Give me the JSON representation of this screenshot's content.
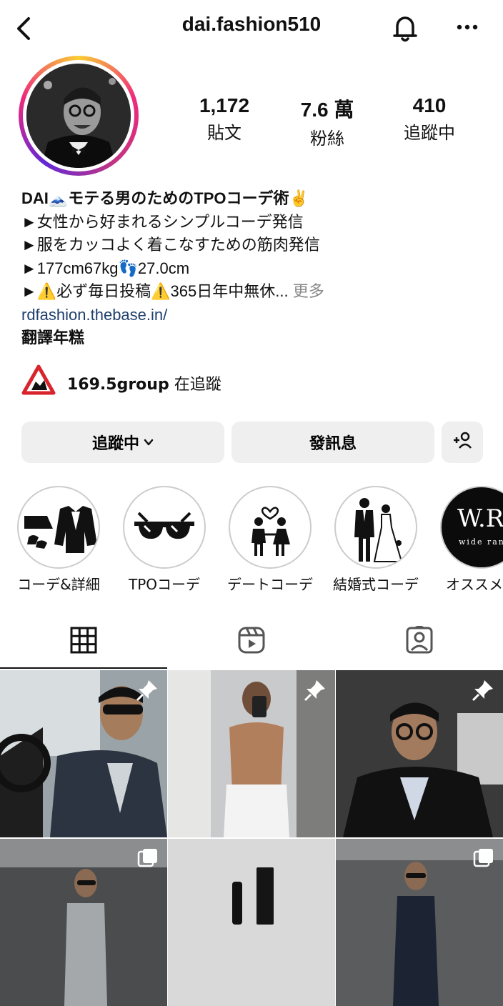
{
  "header": {
    "username": "dai.fashion510",
    "back_icon": "chevron-left-icon",
    "bell_icon": "bell-icon",
    "more_label": "•••"
  },
  "stats": [
    {
      "value": "1,172",
      "label": "貼文"
    },
    {
      "value": "7.6 萬",
      "label": "粉絲"
    },
    {
      "value": "410",
      "label": "追蹤中"
    }
  ],
  "bio": {
    "name_line": "DAI🗻モテる男のためのTPOコーデ術✌️",
    "line1": "►女性から好まれるシンプルコーデ発信",
    "line2": "►服をカッコよく着こなすための筋肉発信",
    "line3": "►177cm67kg👣27.0cm",
    "line4": "►⚠️必ず毎日投稿⚠️365日年中無休...",
    "more": "更多",
    "link": "rdfashion.thebase.in/",
    "translate": "翻譯年糕"
  },
  "group": {
    "name": "169.5group",
    "suffix": "在追蹤"
  },
  "buttons": {
    "following": "追蹤中",
    "message": "發訊息",
    "add_user": "+👤"
  },
  "highlights": [
    {
      "label": "コーデ&詳細"
    },
    {
      "label": "TPOコーデ"
    },
    {
      "label": "デートコーデ"
    },
    {
      "label": "結婚式コーデ"
    },
    {
      "label": "オススメ商"
    }
  ],
  "highlight_wr": {
    "title": "W.R",
    "sub": "wide rang"
  },
  "tabs": [
    "grid-icon",
    "reels-icon",
    "tagged-icon"
  ],
  "colors": {
    "button_bg": "#efefef",
    "link": "#1f3f6e",
    "muted": "#888888"
  }
}
